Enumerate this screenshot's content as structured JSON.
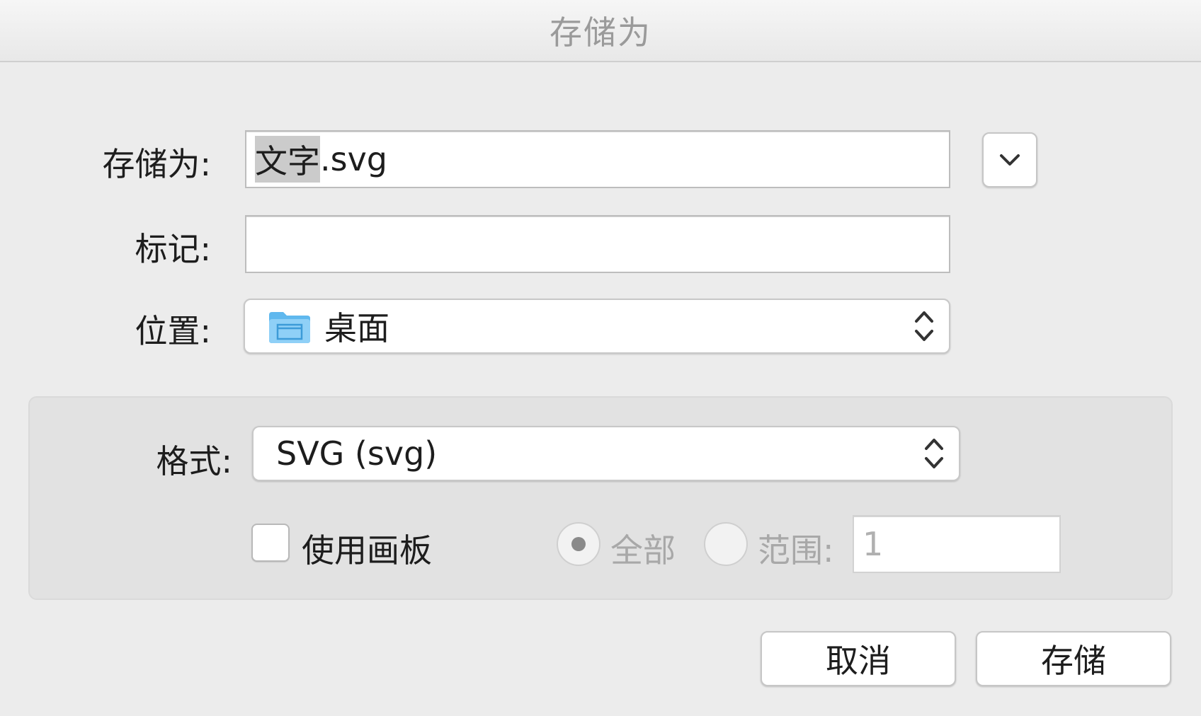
{
  "window": {
    "title": "存储为"
  },
  "form": {
    "save_as_label": "存储为:",
    "filename_selected": "文字",
    "filename_rest": ".svg",
    "tags_label": "标记:",
    "tags_value": "",
    "location_label": "位置:",
    "location_value": "桌面",
    "location_icon": "folder-icon",
    "expand_icon": "chevron-down-icon"
  },
  "options": {
    "format_label": "格式:",
    "format_value": "SVG (svg)",
    "use_artboards_label": "使用画板",
    "use_artboards_checked": false,
    "all_label": "全部",
    "all_selected": true,
    "range_label": "范围:",
    "range_selected": false,
    "range_value": "1"
  },
  "buttons": {
    "cancel_label": "取消",
    "save_label": "存储"
  }
}
